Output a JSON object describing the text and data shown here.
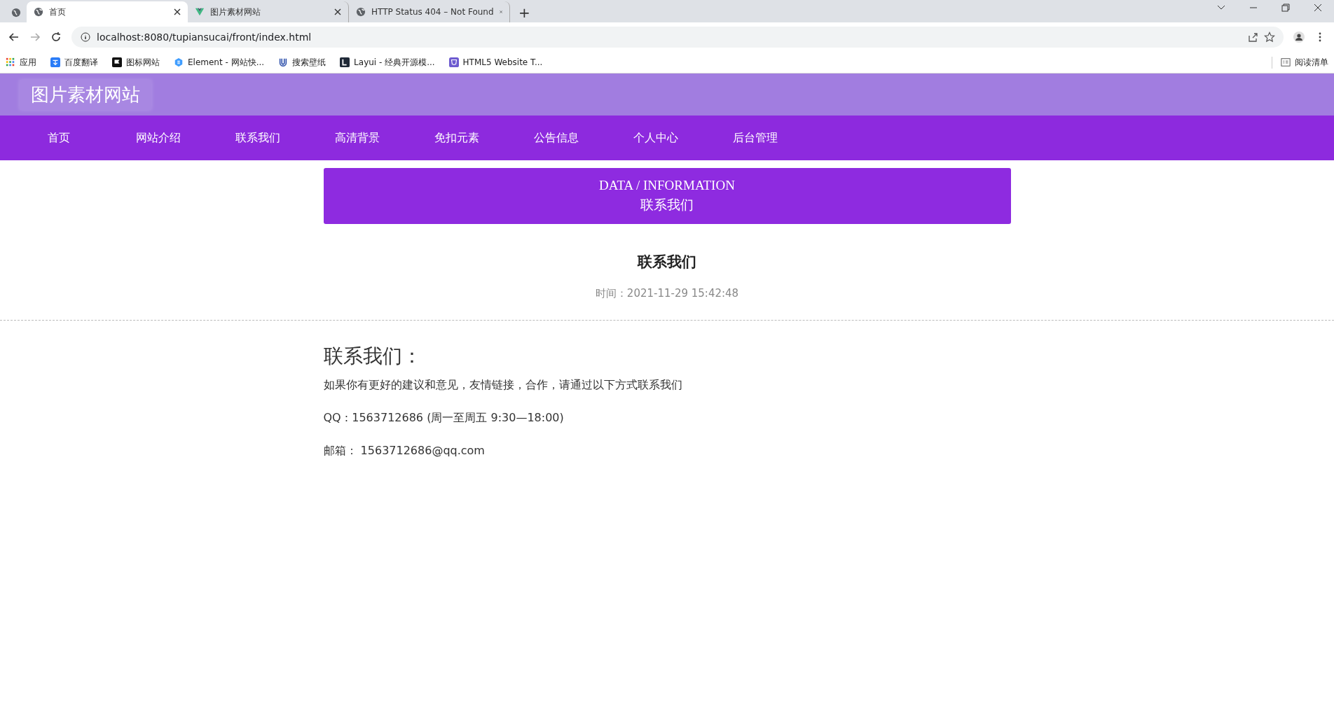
{
  "browser": {
    "tabs": [
      {
        "title": "首页",
        "selected": true
      },
      {
        "title": "图片素材网站",
        "selected": false
      },
      {
        "title": "HTTP Status 404 – Not Found",
        "selected": false
      }
    ],
    "new_tab": "+",
    "address": "localhost:8080/tupiansucai/front/index.html",
    "bookmarks": [
      {
        "label": "应用"
      },
      {
        "label": "百度翻译"
      },
      {
        "label": "图标网站"
      },
      {
        "label": "Element - 网站快..."
      },
      {
        "label": "搜索壁纸"
      },
      {
        "label": "Layui - 经典开源模..."
      },
      {
        "label": "HTML5 Website T..."
      }
    ],
    "reading_list": "阅读清单"
  },
  "site": {
    "logo": "图片素材网站",
    "nav": [
      {
        "label": "首页"
      },
      {
        "label": "网站介绍"
      },
      {
        "label": "联系我们"
      },
      {
        "label": "高清背景"
      },
      {
        "label": "免扣元素"
      },
      {
        "label": "公告信息"
      },
      {
        "label": "个人中心"
      },
      {
        "label": "后台管理"
      }
    ]
  },
  "banner": {
    "subtitle": "DATA / INFORMATION",
    "title": "联系我们"
  },
  "article": {
    "title": "联系我们",
    "time": "时间：2021-11-29 15:42:48",
    "heading": "联系我们：",
    "paragraphs": [
      "如果你有更好的建议和意见，友情链接，合作，请通过以下方式联系我们",
      "QQ : 1563712686 (周一至周五 9:30—18:00)",
      "邮箱：  1563712686@qq.com"
    ]
  }
}
